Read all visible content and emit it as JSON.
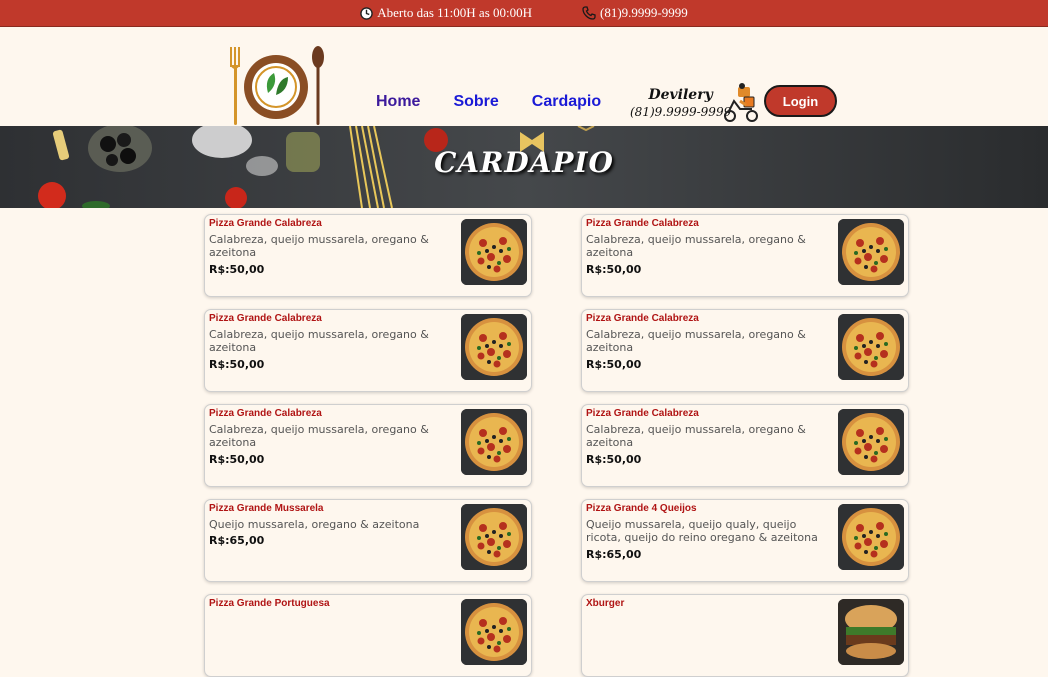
{
  "topbar": {
    "hours": "Aberto das 11:00H as 00:00H",
    "phone": "(81)9.9999-9999",
    "color": "#c0392b"
  },
  "nav": {
    "items": [
      {
        "label": "Home"
      },
      {
        "label": "Sobre"
      },
      {
        "label": "Cardapio"
      }
    ]
  },
  "delivery": {
    "title": "Devilery",
    "phone": "(81)9.9999-9999"
  },
  "login": {
    "label": "Login"
  },
  "banner": {
    "title": "CARDAPIO"
  },
  "menu": {
    "items": [
      {
        "name": "Pizza Grande Calabreza",
        "desc": "Calabreza, queijo mussarela, oregano & azeitona",
        "price": "R$:50,00",
        "icon": "pizza-image"
      },
      {
        "name": "Pizza Grande Calabreza",
        "desc": "Calabreza, queijo mussarela, oregano & azeitona",
        "price": "R$:50,00",
        "icon": "pizza-image"
      },
      {
        "name": "Pizza Grande Calabreza",
        "desc": "Calabreza, queijo mussarela, oregano & azeitona",
        "price": "R$:50,00",
        "icon": "pizza-image"
      },
      {
        "name": "Pizza Grande Calabreza",
        "desc": "Calabreza, queijo mussarela, oregano & azeitona",
        "price": "R$:50,00",
        "icon": "pizza-image"
      },
      {
        "name": "Pizza Grande Calabreza",
        "desc": "Calabreza, queijo mussarela, oregano & azeitona",
        "price": "R$:50,00",
        "icon": "pizza-image"
      },
      {
        "name": "Pizza Grande Calabreza",
        "desc": "Calabreza, queijo mussarela, oregano & azeitona",
        "price": "R$:50,00",
        "icon": "pizza-image"
      },
      {
        "name": "Pizza Grande Mussarela",
        "desc": "Queijo mussarela, oregano & azeitona",
        "price": "R$:65,00",
        "icon": "pizza-image"
      },
      {
        "name": "Pizza Grande 4 Queijos",
        "desc": "Queijo mussarela, queijo qualy, queijo ricota, queijo do reino oregano & azeitona",
        "price": "R$:65,00",
        "icon": "pizza-image"
      },
      {
        "name": "Pizza Grande Portuguesa",
        "desc": "",
        "price": "",
        "icon": "pizza-image"
      },
      {
        "name": "Xburger",
        "desc": "",
        "price": "",
        "icon": "burger-image"
      }
    ]
  }
}
